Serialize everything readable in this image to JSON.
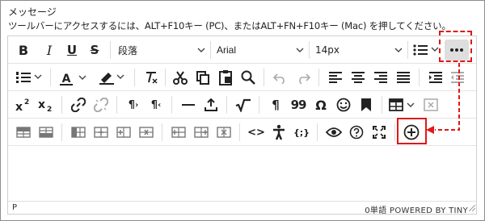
{
  "dialog": {
    "title": "メッセージ",
    "hint": "ツールバーにアクセスするには、ALT+F10キー (PC)、またはALT+FN+F10キー (Mac) を押してください。"
  },
  "toolbar": {
    "format_select": "段落",
    "font_select": "Arial",
    "size_select": "14px",
    "bold": "B",
    "italic": "I",
    "underline": "U",
    "strike": "S",
    "text_color": "A",
    "pilcrow_ltr": "¶",
    "pilcrow_rtl": "¶",
    "pilcrow": "¶",
    "quote": "99",
    "omega": "Ω",
    "source": "<>",
    "code": "{;}"
  },
  "status": {
    "path": "P",
    "word_count": "0単語",
    "powered": "POWERED BY TINY"
  },
  "colors": {
    "highlight": "#e01818",
    "text": "#222222",
    "border": "#cfcfcf"
  }
}
